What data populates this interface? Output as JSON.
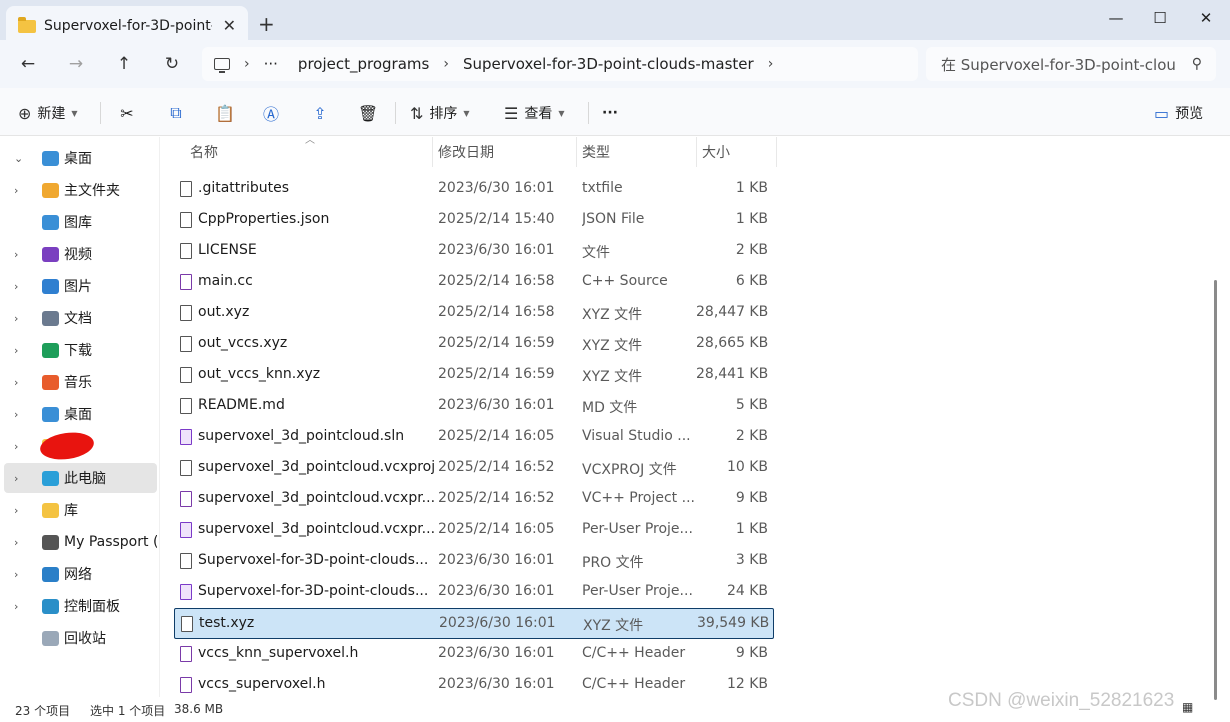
{
  "window": {
    "tab_title": "Supervoxel-for-3D-point-",
    "new_tab": "+",
    "min": "—",
    "max": "☐",
    "close": "✕"
  },
  "nav": {
    "back": "←",
    "forward": "→",
    "up": "↑",
    "refresh": "↻",
    "breadcrumb_more": "···",
    "breadcrumb": [
      "project_programs",
      "Supervoxel-for-3D-point-clouds-master"
    ],
    "search_placeholder": "在 Supervoxel-for-3D-point-clou"
  },
  "toolbar": {
    "new": "新建",
    "sort": "排序",
    "view": "查看",
    "more": "···",
    "preview": "预览"
  },
  "sidebar": {
    "items": [
      {
        "label": "桌面",
        "color": "#3a8fd6",
        "expanded": true
      },
      {
        "label": "主文件夹",
        "color": "#f0a830"
      },
      {
        "label": "图库",
        "color": "#3a8fd6"
      },
      {
        "label": "视频",
        "color": "#7a3fc0"
      },
      {
        "label": "图片",
        "color": "#2f7fd0"
      },
      {
        "label": "文档",
        "color": "#6b7a8f"
      },
      {
        "label": "下载",
        "color": "#1e9e5a"
      },
      {
        "label": "音乐",
        "color": "#e85c2c"
      },
      {
        "label": "桌面",
        "color": "#3a8fd6"
      },
      {
        "label": "",
        "color": "#f4c342"
      },
      {
        "label": "此电脑",
        "color": "#2a9fd8"
      },
      {
        "label": "库",
        "color": "#f4c342"
      },
      {
        "label": "My Passport (I",
        "color": "#555555"
      },
      {
        "label": "网络",
        "color": "#2a7fc8"
      },
      {
        "label": "控制面板",
        "color": "#2a8fc8"
      },
      {
        "label": "回收站",
        "color": "#9aa8b8"
      }
    ]
  },
  "columns": {
    "name": "名称",
    "date": "修改日期",
    "type": "类型",
    "size": "大小"
  },
  "files": [
    {
      "name": ".gitattributes",
      "date": "2023/6/30 16:01",
      "type": "txtfile",
      "size": "1 KB",
      "icon": "doc"
    },
    {
      "name": "CppProperties.json",
      "date": "2025/2/14 15:40",
      "type": "JSON File",
      "size": "1 KB",
      "icon": "doc"
    },
    {
      "name": "LICENSE",
      "date": "2023/6/30 16:01",
      "type": "文件",
      "size": "2 KB",
      "icon": "doc"
    },
    {
      "name": "main.cc",
      "date": "2025/2/14 16:58",
      "type": "C++ Source",
      "size": "6 KB",
      "icon": "code"
    },
    {
      "name": "out.xyz",
      "date": "2025/2/14 16:58",
      "type": "XYZ 文件",
      "size": "28,447 KB",
      "icon": "doc"
    },
    {
      "name": "out_vccs.xyz",
      "date": "2025/2/14 16:59",
      "type": "XYZ 文件",
      "size": "28,665 KB",
      "icon": "doc"
    },
    {
      "name": "out_vccs_knn.xyz",
      "date": "2025/2/14 16:59",
      "type": "XYZ 文件",
      "size": "28,441 KB",
      "icon": "doc"
    },
    {
      "name": "README.md",
      "date": "2023/6/30 16:01",
      "type": "MD 文件",
      "size": "5 KB",
      "icon": "doc"
    },
    {
      "name": "supervoxel_3d_pointcloud.sln",
      "date": "2025/2/14 16:05",
      "type": "Visual Studio ...",
      "size": "2 KB",
      "icon": "sln"
    },
    {
      "name": "supervoxel_3d_pointcloud.vcxproj",
      "date": "2025/2/14 16:52",
      "type": "VCXPROJ 文件",
      "size": "10 KB",
      "icon": "doc"
    },
    {
      "name": "supervoxel_3d_pointcloud.vcxpr...",
      "date": "2025/2/14 16:52",
      "type": "VC++ Project ...",
      "size": "9 KB",
      "icon": "code"
    },
    {
      "name": "supervoxel_3d_pointcloud.vcxpr...",
      "date": "2025/2/14 16:05",
      "type": "Per-User Proje...",
      "size": "1 KB",
      "icon": "sln"
    },
    {
      "name": "Supervoxel-for-3D-point-clouds...",
      "date": "2023/6/30 16:01",
      "type": "PRO 文件",
      "size": "3 KB",
      "icon": "doc"
    },
    {
      "name": "Supervoxel-for-3D-point-clouds...",
      "date": "2023/6/30 16:01",
      "type": "Per-User Proje...",
      "size": "24 KB",
      "icon": "sln"
    },
    {
      "name": "test.xyz",
      "date": "2023/6/30 16:01",
      "type": "XYZ 文件",
      "size": "39,549 KB",
      "icon": "doc",
      "selected": true
    },
    {
      "name": "vccs_knn_supervoxel.h",
      "date": "2023/6/30 16:01",
      "type": "C/C++ Header",
      "size": "9 KB",
      "icon": "code"
    },
    {
      "name": "vccs_supervoxel.h",
      "date": "2023/6/30 16:01",
      "type": "C/C++ Header",
      "size": "12 KB",
      "icon": "code"
    }
  ],
  "status": {
    "count": "23 个项目",
    "selection": "选中 1 个项目",
    "selection_size": "38.6 MB"
  },
  "watermark": "CSDN @weixin_52821623"
}
